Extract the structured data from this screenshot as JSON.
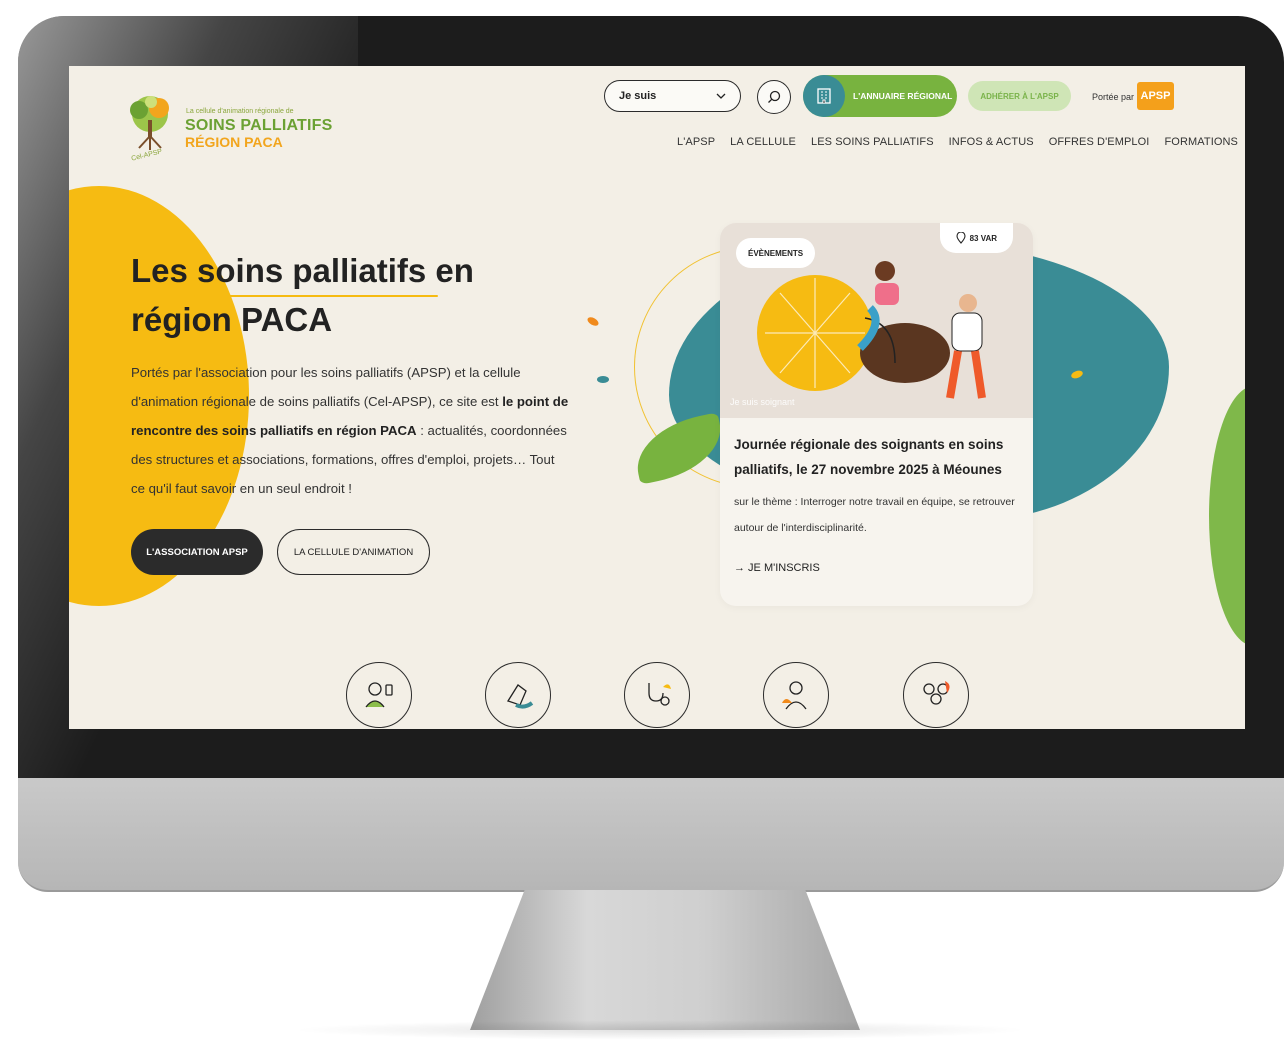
{
  "header": {
    "logo": {
      "small_text": "La cellule d'animation régionale de",
      "main_text": "SOINS PALLIATIFS",
      "region_text": "RÉGION PACA",
      "badge_text": "Cel-APSP"
    },
    "profile_select": {
      "value": "Je suis"
    },
    "annuaire_label": "L'ANNUAIRE RÉGIONAL",
    "adherer_label": "ADHÉRER À L'APSP",
    "portee_label": "Portée par",
    "apsp_logo_text": "APSP",
    "nav": [
      "L'APSP",
      "LA CELLULE",
      "LES SOINS PALLIATIFS",
      "INFOS & ACTUS",
      "OFFRES D'EMPLOI",
      "FORMATIONS"
    ]
  },
  "hero": {
    "title_line1": "Les soins palliatifs en",
    "title_line2": "région PACA",
    "body_part1": "Portés par l'association pour les soins palliatifs (APSP) et la cellule d'animation régionale de soins palliatifs (Cel-APSP), ce site est ",
    "body_bold": "le point de rencontre des soins palliatifs en région PACA",
    "body_part2": " : actualités, coordonnées des structures et associations, formations, offres d'emploi, projets… Tout ce qu'il faut savoir en un seul endroit !",
    "btn_primary": "L'ASSOCIATION APSP",
    "btn_secondary": "LA CELLULE D'ANIMATION"
  },
  "event_card": {
    "badge": "ÉVÈNEMENTS",
    "location": "83 VAR",
    "tag": "Je suis soignant",
    "title": "Journée régionale des soignants en soins palliatifs, le 27 novembre 2025 à Méounes",
    "description": "sur le thème : Interroger notre travail en équipe, se retrouver autour de l'interdisciplinarité.",
    "cta": "→ JE M'INSCRIS"
  },
  "categories": [
    {
      "icon": "patient-icon"
    },
    {
      "icon": "hands-support-icon"
    },
    {
      "icon": "stethoscope-icon"
    },
    {
      "icon": "caregiver-icon"
    },
    {
      "icon": "group-icon"
    }
  ],
  "colors": {
    "yellow": "#f6bb12",
    "green": "#78b33f",
    "teal": "#3a8c95",
    "dark": "#2b2b2b",
    "orange": "#f4a01b"
  }
}
